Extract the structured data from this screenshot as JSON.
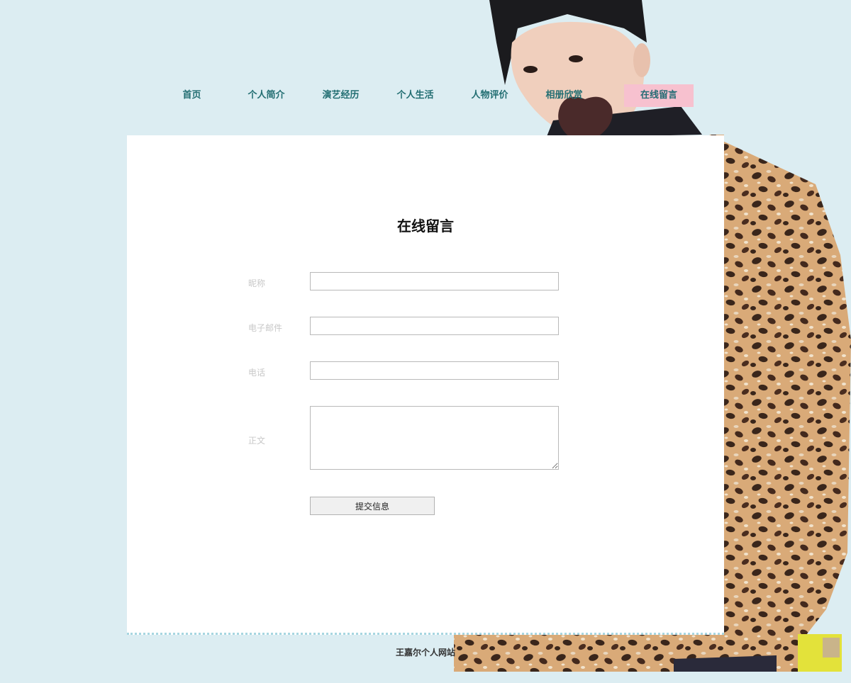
{
  "nav": {
    "items": [
      {
        "label": "首页"
      },
      {
        "label": "个人简介"
      },
      {
        "label": "演艺经历"
      },
      {
        "label": "个人生活"
      },
      {
        "label": "人物评价"
      },
      {
        "label": "相册欣赏"
      },
      {
        "label": "在线留言",
        "active": true
      }
    ]
  },
  "page": {
    "title": "在线留言"
  },
  "form": {
    "nickname_label": "昵称",
    "nickname_value": "",
    "email_label": "电子邮件",
    "email_value": "",
    "phone_label": "电话",
    "phone_value": "",
    "body_label": "正文",
    "body_value": "",
    "submit_label": "提交信息"
  },
  "footer": {
    "text": "王嘉尔个人网站"
  },
  "colors": {
    "background": "#dcedf2",
    "nav_text": "#226e72",
    "nav_active_bg": "#f7c1cf",
    "panel_bg": "#ffffff"
  },
  "images": {
    "hero": "photo of person in leopard-print jacket (decorative)"
  }
}
